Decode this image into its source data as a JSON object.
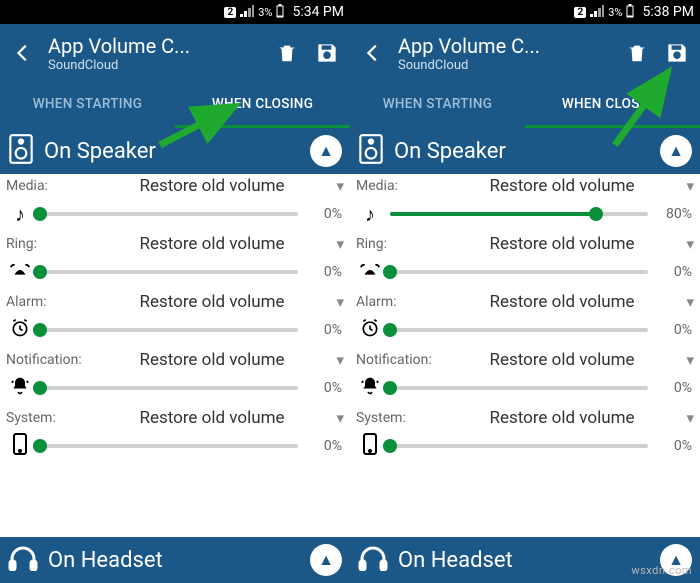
{
  "panes": [
    {
      "status": {
        "sim": "2",
        "battery": "3%",
        "time": "5:34 PM"
      },
      "appbar": {
        "title": "App Volume C...",
        "subtitle": "SoundCloud"
      },
      "tabs": {
        "start": "WHEN STARTING",
        "close": "WHEN CLOSING",
        "active": "close"
      },
      "speaker_header": "On Speaker",
      "headset_header": "On Headset",
      "rows": [
        {
          "label": "Media:",
          "value": "Restore old volume",
          "icon": "note",
          "pct": 0
        },
        {
          "label": "Ring:",
          "value": "Restore old volume",
          "icon": "ring",
          "pct": 0
        },
        {
          "label": "Alarm:",
          "value": "Restore old volume",
          "icon": "alarm",
          "pct": 0
        },
        {
          "label": "Notification:",
          "value": "Restore old volume",
          "icon": "bell",
          "pct": 0
        },
        {
          "label": "System:",
          "value": "Restore old volume",
          "icon": "phone",
          "pct": 0
        }
      ]
    },
    {
      "status": {
        "sim": "2",
        "battery": "3%",
        "time": "5:38 PM"
      },
      "appbar": {
        "title": "App Volume C...",
        "subtitle": "SoundCloud"
      },
      "tabs": {
        "start": "WHEN STARTING",
        "close": "WHEN CLOSING",
        "active": "close"
      },
      "speaker_header": "On Speaker",
      "headset_header": "On Headset",
      "rows": [
        {
          "label": "Media:",
          "value": "Restore old volume",
          "icon": "note",
          "pct": 80
        },
        {
          "label": "Ring:",
          "value": "Restore old volume",
          "icon": "ring",
          "pct": 0
        },
        {
          "label": "Alarm:",
          "value": "Restore old volume",
          "icon": "alarm",
          "pct": 0
        },
        {
          "label": "Notification:",
          "value": "Restore old volume",
          "icon": "bell",
          "pct": 0
        },
        {
          "label": "System:",
          "value": "Restore old volume",
          "icon": "phone",
          "pct": 0
        }
      ],
      "watermark": "wsxdn.com"
    }
  ],
  "icons": {
    "note": "♪",
    "alarm": "⏰",
    "bell": "🔔",
    "phone": "📱",
    "dd": "▾",
    "up": "▲"
  }
}
